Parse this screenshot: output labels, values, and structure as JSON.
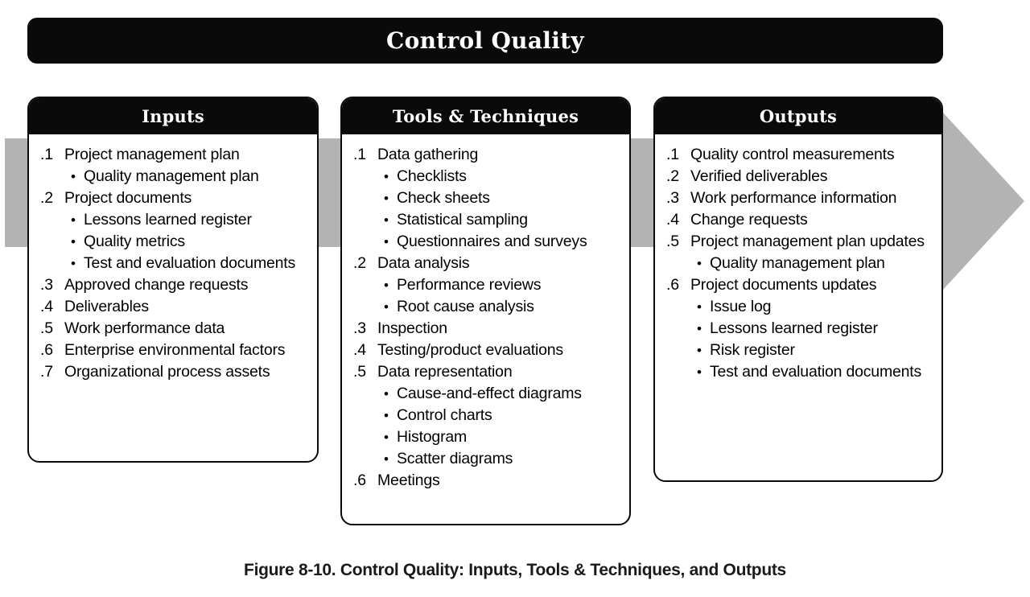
{
  "process": {
    "title": "Control Quality"
  },
  "arrow": {
    "color": "#b3b3b3",
    "name": "process-flow-arrow"
  },
  "columns": [
    {
      "id": "inputs",
      "header": "Inputs",
      "items": [
        {
          "num": ".1",
          "text": "Project management plan",
          "subs": [
            "Quality management plan"
          ]
        },
        {
          "num": ".2",
          "text": "Project documents",
          "subs": [
            "Lessons learned register",
            "Quality metrics",
            "Test and evaluation documents"
          ]
        },
        {
          "num": ".3",
          "text": "Approved change requests",
          "subs": []
        },
        {
          "num": ".4",
          "text": "Deliverables",
          "subs": []
        },
        {
          "num": ".5",
          "text": "Work performance data",
          "subs": []
        },
        {
          "num": ".6",
          "text": "Enterprise environmental factors",
          "subs": []
        },
        {
          "num": ".7",
          "text": "Organizational process assets",
          "subs": []
        }
      ]
    },
    {
      "id": "tools",
      "header": "Tools & Techniques",
      "items": [
        {
          "num": ".1",
          "text": "Data gathering",
          "subs": [
            "Checklists",
            "Check sheets",
            "Statistical sampling",
            "Questionnaires and surveys"
          ]
        },
        {
          "num": ".2",
          "text": "Data analysis",
          "subs": [
            "Performance reviews",
            "Root cause analysis"
          ]
        },
        {
          "num": ".3",
          "text": "Inspection",
          "subs": []
        },
        {
          "num": ".4",
          "text": "Testing/product evaluations",
          "subs": []
        },
        {
          "num": ".5",
          "text": "Data representation",
          "subs": [
            "Cause-and-effect diagrams",
            "Control charts",
            "Histogram",
            "Scatter diagrams"
          ]
        },
        {
          "num": ".6",
          "text": "Meetings",
          "subs": []
        }
      ]
    },
    {
      "id": "outputs",
      "header": "Outputs",
      "items": [
        {
          "num": ".1",
          "text": "Quality control measurements",
          "subs": []
        },
        {
          "num": ".2",
          "text": "Verified deliverables",
          "subs": []
        },
        {
          "num": ".3",
          "text": "Work performance information",
          "subs": []
        },
        {
          "num": ".4",
          "text": "Change requests",
          "subs": []
        },
        {
          "num": ".5",
          "text": "Project management plan updates",
          "subs": [
            "Quality management plan"
          ]
        },
        {
          "num": ".6",
          "text": "Project documents updates",
          "subs": [
            "Issue log",
            "Lessons learned register",
            "Risk register",
            "Test and evaluation documents"
          ]
        }
      ]
    }
  ],
  "caption": "Figure 8-10. Control Quality: Inputs, Tools & Techniques, and Outputs",
  "bullet_glyph": "•"
}
